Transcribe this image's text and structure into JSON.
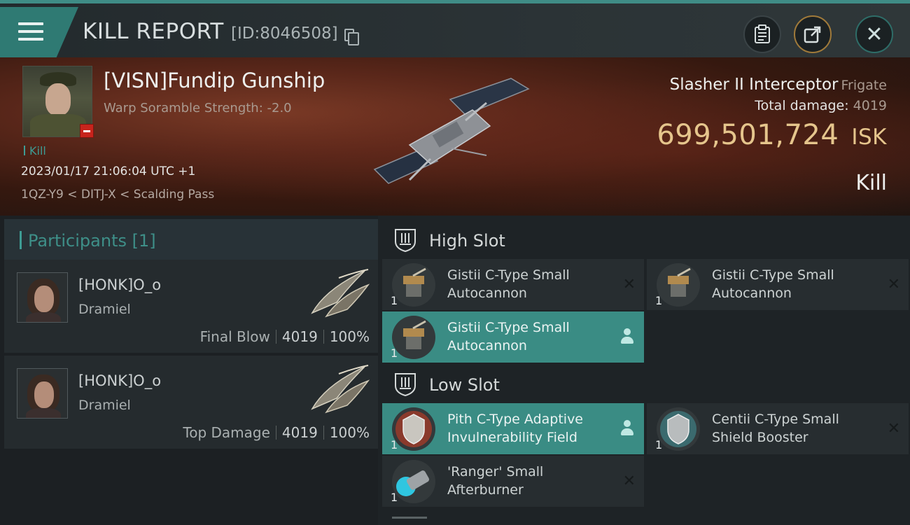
{
  "header": {
    "title": "KILL REPORT",
    "report_id": "[ID:8046508]"
  },
  "victim": {
    "name": "[VISN]Fundip Gunship",
    "scramble": "Warp Soramble Strength: -2.0",
    "kill_tag": "Kill",
    "date": "2023/01/17 21:06:04 UTC +1",
    "location": "1QZ-Y9 < DITJ-X < Scalding Pass",
    "ship_name": "Slasher II Interceptor",
    "ship_class": "Frigate",
    "total_damage_label": "Total damage:",
    "total_damage": "4019",
    "isk_value": "699,501,724",
    "isk_unit": "ISK",
    "result": "Kill"
  },
  "participants": {
    "header": "Participants [1]",
    "items": [
      {
        "name": "[HONK]O_o",
        "corp": "Dramiel",
        "role": "Final Blow",
        "damage": "4019",
        "percent": "100%"
      },
      {
        "name": "[HONK]O_o",
        "corp": "Dramiel",
        "role": "Top Damage",
        "damage": "4019",
        "percent": "100%"
      }
    ]
  },
  "fitting": {
    "high_slot_label": "High Slot",
    "low_slot_label": "Low Slot",
    "high": [
      {
        "name": "Gistii C-Type Small Autocannon",
        "qty": "1",
        "action": "✕"
      },
      {
        "name": "Gistii C-Type Small Autocannon",
        "qty": "1",
        "action": "✕"
      },
      {
        "name": "Gistii C-Type Small Autocannon",
        "qty": "1",
        "action": "person"
      }
    ],
    "low": [
      {
        "name": "Pith C-Type Adaptive Invulnerability Field",
        "qty": "1",
        "action": "person"
      },
      {
        "name": "Centii C-Type Small Shield Booster",
        "qty": "1",
        "action": "✕"
      },
      {
        "name": "'Ranger' Small Afterburner",
        "qty": "1",
        "action": "✕"
      }
    ]
  },
  "colors": {
    "accent": "#3e9c94",
    "isk_gold": "#e5c58c",
    "active_module": "#3a8c84"
  }
}
